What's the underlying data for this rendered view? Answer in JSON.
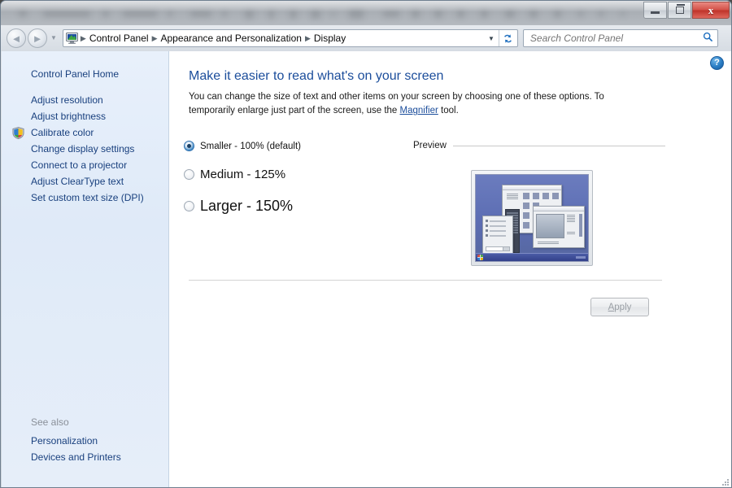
{
  "window": {
    "controls": {
      "minimize_label": "Minimize",
      "maximize_label": "Maximize",
      "close_label": "x"
    }
  },
  "navbar": {
    "back_label": "◄",
    "forward_label": "►",
    "history_dropdown_label": "▼",
    "address_icon": "display-monitor-icon",
    "breadcrumbs": [
      {
        "label": "Control Panel"
      },
      {
        "label": "Appearance and Personalization"
      },
      {
        "label": "Display"
      }
    ],
    "separator": "▶",
    "address_chevron": "▼",
    "refresh_label": "↻",
    "search": {
      "placeholder": "Search Control Panel",
      "value": "",
      "icon": "search-icon"
    }
  },
  "sidebar": {
    "home_label": "Control Panel Home",
    "items": [
      {
        "label": "Adjust resolution",
        "shield": false
      },
      {
        "label": "Adjust brightness",
        "shield": false
      },
      {
        "label": "Calibrate color",
        "shield": true
      },
      {
        "label": "Change display settings",
        "shield": false
      },
      {
        "label": "Connect to a projector",
        "shield": false
      },
      {
        "label": "Adjust ClearType text",
        "shield": false
      },
      {
        "label": "Set custom text size (DPI)",
        "shield": false
      }
    ],
    "see_also_title": "See also",
    "see_also": [
      {
        "label": "Personalization"
      },
      {
        "label": "Devices and Printers"
      }
    ]
  },
  "main": {
    "help_label": "?",
    "title": "Make it easier to read what's on your screen",
    "description_part1": "You can change the size of text and other items on your screen by choosing one of these options. To temporarily enlarge just part of the screen, use the ",
    "description_link": "Magnifier",
    "description_part2": " tool.",
    "options": [
      {
        "label": "Smaller - 100% (default)",
        "selected": true
      },
      {
        "label": "Medium - 125%",
        "selected": false
      },
      {
        "label": "Larger - 150%",
        "selected": false
      }
    ],
    "preview_label": "Preview",
    "apply_accesskey": "A",
    "apply_rest": "pply",
    "apply_enabled": false
  },
  "colors": {
    "link_blue": "#19407e",
    "title_blue": "#1b4d9b",
    "sidebar_bg": "#e6eef9",
    "accent": "#2a6ca8"
  }
}
